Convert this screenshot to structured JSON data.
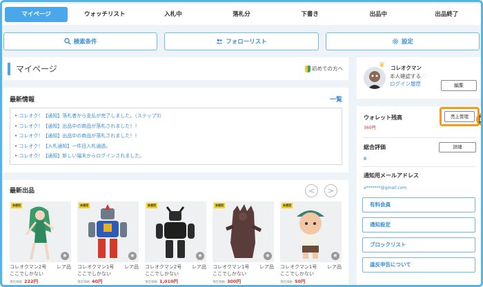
{
  "tabs": [
    {
      "label": "マイページ",
      "active": true
    },
    {
      "label": "ウォッチリスト",
      "active": false
    },
    {
      "label": "入札中",
      "active": false
    },
    {
      "label": "落札分",
      "active": false
    },
    {
      "label": "下書き",
      "active": false
    },
    {
      "label": "出品中",
      "active": false
    },
    {
      "label": "出品終了",
      "active": false
    }
  ],
  "actions": {
    "search": "検索条件",
    "follow": "フォローリスト",
    "settings": "設定"
  },
  "mypage": {
    "title": "マイページ",
    "beginner_link": "初めての方へ"
  },
  "news": {
    "title": "最新情報",
    "more": "一覧",
    "items": [
      "コレオク！【通知】落札者から支払が完了しました。（ステップ3）",
      "コレオク！【通知】出品中の商品が落札されました！！",
      "コレオク！【通知】出品中の商品が落札されました！！",
      "コレオク！【入札通知】一件目入札通過。",
      "コレオク！【通知】新しい端末からログインされました。"
    ]
  },
  "new_items": {
    "title": "最新出品",
    "prev": "<",
    "next": ">",
    "badge": "未使用",
    "price_label": "現在価格",
    "items": [
      {
        "seller": "コレオクマン2号",
        "tag": "レア品",
        "desc": "ここでしかない",
        "price": "222円"
      },
      {
        "seller": "コレオクマン1号",
        "tag": "レア品",
        "desc": "ここでしかない",
        "price": "40円"
      },
      {
        "seller": "コレオクマン2号",
        "tag": "レア品",
        "desc": "ここでしかない",
        "price": "1,010円"
      },
      {
        "seller": "コレオクマン1号",
        "tag": "レア品",
        "desc": "ここでしかない",
        "price": "300円"
      },
      {
        "seller": "コレオクマン1号",
        "tag": "レア品",
        "desc": "ここでしかない",
        "price": "50円"
      }
    ]
  },
  "profile": {
    "name": "コレオクマン",
    "verify": "本人確認する",
    "login_history": "ログイン履歴",
    "edit": "編集"
  },
  "wallet": {
    "label": "ウォレット残高",
    "value": "360円",
    "sales_button": "売上管理"
  },
  "rating": {
    "label": "総合評価",
    "value": "0",
    "detail_button": "詳細"
  },
  "email": {
    "label": "通知用メールアドレス",
    "value": "a*******@gmail.com"
  },
  "links": [
    "有料会員",
    "通知設定",
    "ブロックリスト",
    "違反申告について"
  ],
  "colors": {
    "accent": "#4aa8ea",
    "price": "#d9322b",
    "highlight": "#f19a1e"
  }
}
